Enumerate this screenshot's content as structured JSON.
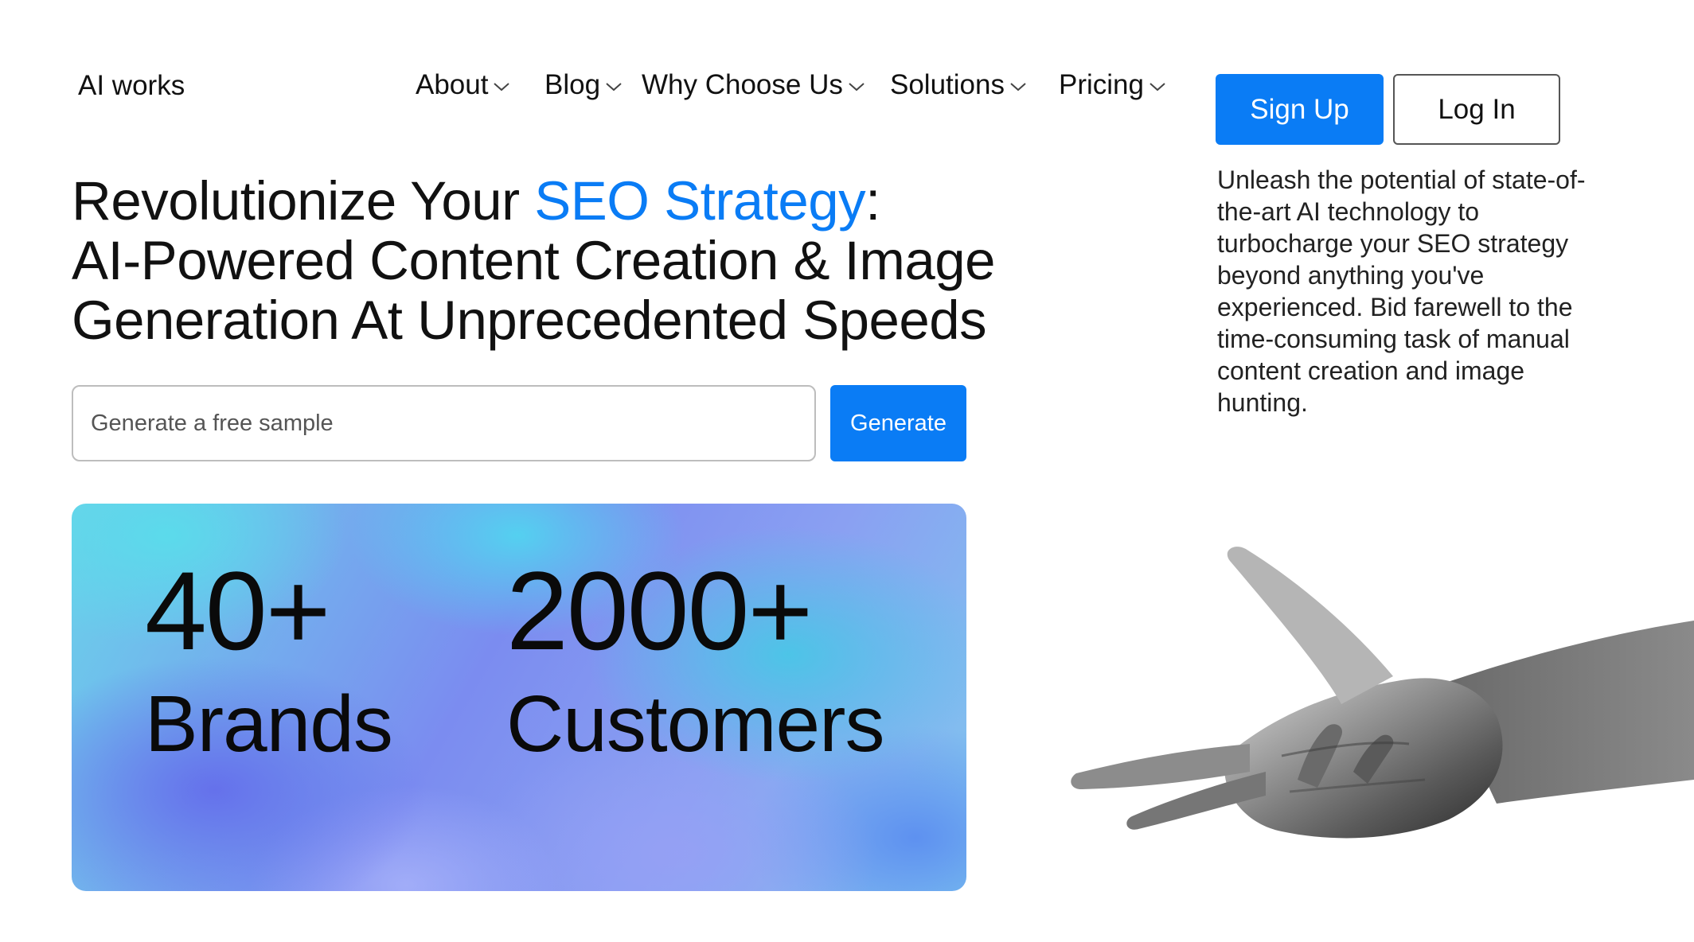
{
  "header": {
    "brand": "AI works",
    "nav": [
      {
        "label": "About",
        "icon": "chevron-down-icon"
      },
      {
        "label": "Blog",
        "icon": "chevron-down-icon"
      },
      {
        "label": "Why Choose Us",
        "icon": "chevron-down-icon"
      },
      {
        "label": "Solutions",
        "icon": "chevron-down-icon"
      },
      {
        "label": "Pricing",
        "icon": "chevron-down-icon"
      }
    ],
    "signup_label": "Sign Up",
    "login_label": "Log In"
  },
  "hero": {
    "headline_line1_pre": "Revolutionize Your ",
    "headline_line1_highlight": "SEO Strategy",
    "headline_line1_post": ":",
    "headline_line2": "AI-Powered Content Creation & Image",
    "headline_line3": "Generation At Unprecedented Speeds",
    "description": "Unleash the potential of state-of-the-art AI technology to turbocharge your SEO strategy beyond anything you've experienced. Bid farewell to the time-consuming task of manual content creation and image hunting."
  },
  "form": {
    "placeholder": "Generate a free sample",
    "value": "",
    "button_label": "Generate"
  },
  "stats": [
    {
      "number": "40+",
      "label": "Brands"
    },
    {
      "number": "2000+",
      "label": "Customers"
    }
  ],
  "colors": {
    "accent": "#0a7cf5",
    "text": "#111111",
    "background": "#ffffff"
  },
  "images": {
    "hero_image": "black-and-white-hand"
  }
}
